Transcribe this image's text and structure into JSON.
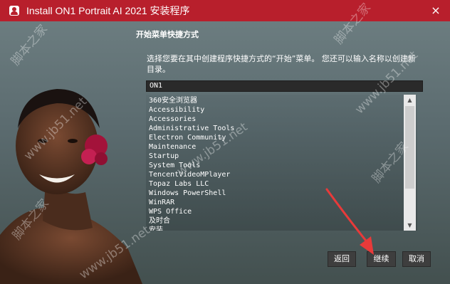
{
  "window": {
    "title": "Install ON1 Portrait AI 2021 安装程序",
    "close_icon": "×"
  },
  "page": {
    "section_title": "开始菜单快捷方式",
    "description": "选择您要在其中创建程序快捷方式的“开始”菜单。 您还可以输入名称以创建新目录。"
  },
  "folder_input": {
    "value": "ON1"
  },
  "folder_list": {
    "items": [
      "360安全浏览器",
      "Accessibility",
      "Accessories",
      "Administrative Tools",
      "Electron Community",
      "Maintenance",
      "Startup",
      "System Tools",
      "TencentVideoMPlayer",
      "Topaz Labs LLC",
      "Windows PowerShell",
      "WinRAR",
      "WPS Office",
      "及时合",
      "安装"
    ]
  },
  "buttons": {
    "back": "返回",
    "next": "继续",
    "cancel": "取消"
  },
  "watermarks": [
    "脚本之家",
    "www.jb51.net",
    "脚本之家",
    "www.jb51.net",
    "脚本之家",
    "www.jb51.net",
    "脚本之家",
    "www.jb51.net"
  ],
  "colors": {
    "title_bar": "#b81f2c",
    "arrow": "#e83a3a",
    "button_bg": "#3e3e3e"
  }
}
